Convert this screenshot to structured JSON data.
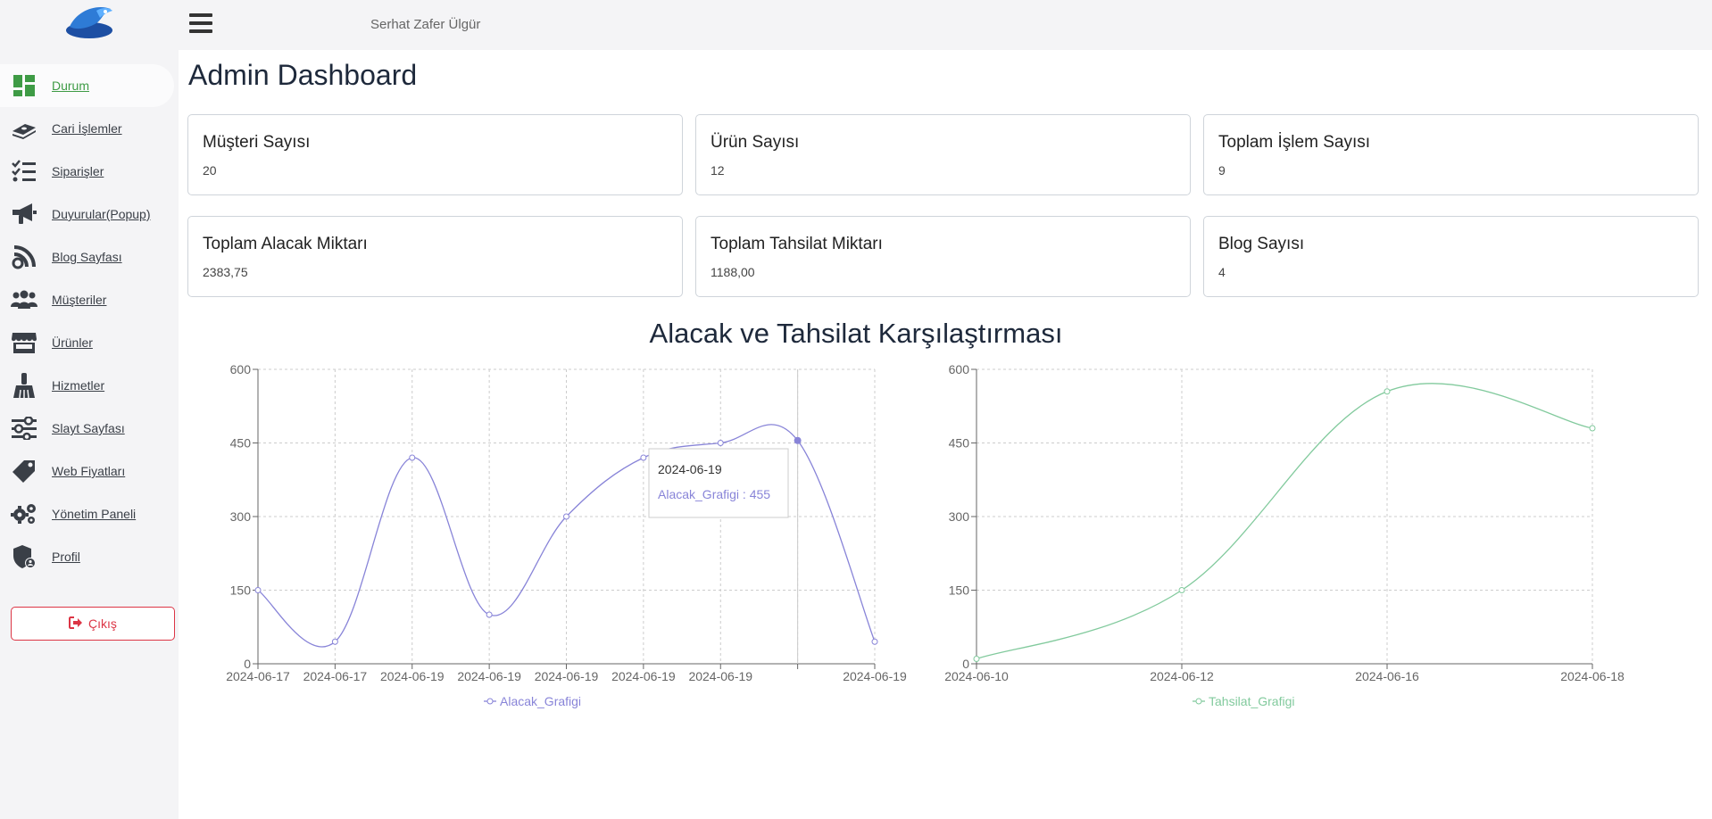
{
  "topbar": {
    "user_name": "Serhat Zafer Ülgür"
  },
  "sidebar": {
    "items": [
      {
        "label": "Durum",
        "icon": "dashboard-icon"
      },
      {
        "label": "Cari İşlemler",
        "icon": "money-icon"
      },
      {
        "label": "Siparişler",
        "icon": "list-check-icon"
      },
      {
        "label": "Duyurular(Popup)",
        "icon": "megaphone-icon"
      },
      {
        "label": "Blog Sayfası",
        "icon": "blog-icon"
      },
      {
        "label": "Müşteriler",
        "icon": "users-icon"
      },
      {
        "label": "Ürünler",
        "icon": "store-icon"
      },
      {
        "label": "Hizmetler",
        "icon": "broom-icon"
      },
      {
        "label": "Slayt Sayfası",
        "icon": "sliders-icon"
      },
      {
        "label": "Web Fiyatları",
        "icon": "tag-icon"
      },
      {
        "label": "Yönetim Paneli",
        "icon": "gears-icon"
      },
      {
        "label": "Profil",
        "icon": "user-shield-icon"
      }
    ],
    "logout_label": "Çıkış"
  },
  "page": {
    "title": "Admin Dashboard"
  },
  "stats": [
    {
      "title": "Müşteri Sayısı",
      "value": "20"
    },
    {
      "title": "Ürün Sayısı",
      "value": "12"
    },
    {
      "title": "Toplam İşlem Sayısı",
      "value": "9"
    },
    {
      "title": "Toplam Alacak Miktarı",
      "value": "2383,75"
    },
    {
      "title": "Toplam Tahsilat Miktarı",
      "value": "1188,00"
    },
    {
      "title": "Blog Sayısı",
      "value": "4"
    }
  ],
  "charts_title": "Alacak ve Tahsilat Karşılaştırması",
  "colors": {
    "alacak": "#8884d8",
    "tahsilat": "#82ca9d",
    "accent_green": "#3e9b45",
    "danger": "#dc3545"
  },
  "chart_data": [
    {
      "type": "line",
      "title": "",
      "x": [
        "2024-06-17",
        "2024-06-17",
        "2024-06-19",
        "2024-06-19",
        "2024-06-19",
        "2024-06-19",
        "2024-06-19",
        "2024-06-19",
        "2024-06-19"
      ],
      "tick_labels": [
        "2024-06-17",
        "2024-06-17",
        "2024-06-19",
        "2024-06-19",
        "2024-06-19",
        "2024-06-19",
        "2024-06-19",
        "",
        "2024-06-19"
      ],
      "series": [
        {
          "name": "Alacak_Grafigi",
          "values": [
            150,
            45,
            420,
            100,
            300,
            420,
            450,
            455,
            45
          ]
        }
      ],
      "ylim": [
        0,
        600
      ],
      "yticks": [
        0,
        150,
        300,
        450,
        600
      ],
      "grid": true,
      "legend": "bottom",
      "tooltip": {
        "index": 7,
        "label": "2024-06-19",
        "text": "Alacak_Grafigi : 455"
      }
    },
    {
      "type": "line",
      "title": "",
      "x": [
        "2024-06-10",
        "2024-06-12",
        "2024-06-16",
        "2024-06-18"
      ],
      "tick_labels": [
        "2024-06-10",
        "2024-06-12",
        "2024-06-16",
        "2024-06-18"
      ],
      "series": [
        {
          "name": "Tahsilat_Grafigi",
          "values": [
            10,
            150,
            555,
            480
          ]
        }
      ],
      "ylim": [
        0,
        600
      ],
      "yticks": [
        0,
        150,
        300,
        450,
        600
      ],
      "grid": true,
      "legend": "bottom"
    }
  ]
}
